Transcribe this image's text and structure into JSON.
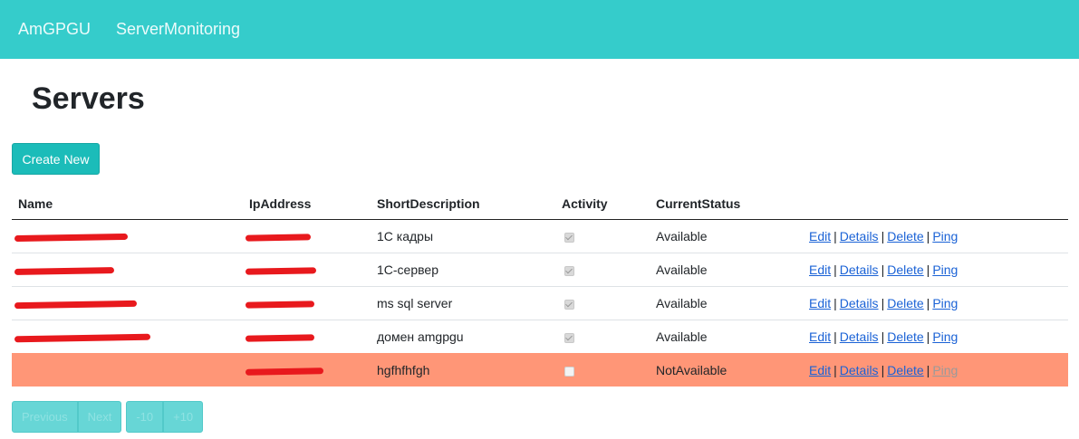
{
  "nav": {
    "brand": "AmGPGU",
    "link": "ServerMonitoring"
  },
  "page": {
    "title": "Servers",
    "create_label": "Create New"
  },
  "table": {
    "headers": [
      "Name",
      "IpAddress",
      "ShortDescription",
      "Activity",
      "CurrentStatus"
    ],
    "rows": [
      {
        "description": "1С кадры",
        "active": true,
        "status": "Available",
        "ping_enabled": true
      },
      {
        "description": "1С-сервер",
        "active": true,
        "status": "Available",
        "ping_enabled": true
      },
      {
        "description": "ms sql server",
        "active": true,
        "status": "Available",
        "ping_enabled": true
      },
      {
        "description": "домен amgpgu",
        "active": true,
        "status": "Available",
        "ping_enabled": true
      },
      {
        "description": "hgfhfhfgh",
        "active": false,
        "status": "NotAvailable",
        "ping_enabled": false
      }
    ],
    "actions": {
      "edit": "Edit",
      "details": "Details",
      "delete": "Delete",
      "ping": "Ping",
      "separator": "|"
    }
  },
  "pager": {
    "previous": "Previous",
    "next": "Next",
    "minus": "-10",
    "plus": "+10"
  },
  "colors": {
    "navbar": "#35cccb",
    "accent": "#1bbcb9",
    "unavailable_row": "#ff9677",
    "redaction": "#e8191d",
    "link": "#1a62d6"
  }
}
